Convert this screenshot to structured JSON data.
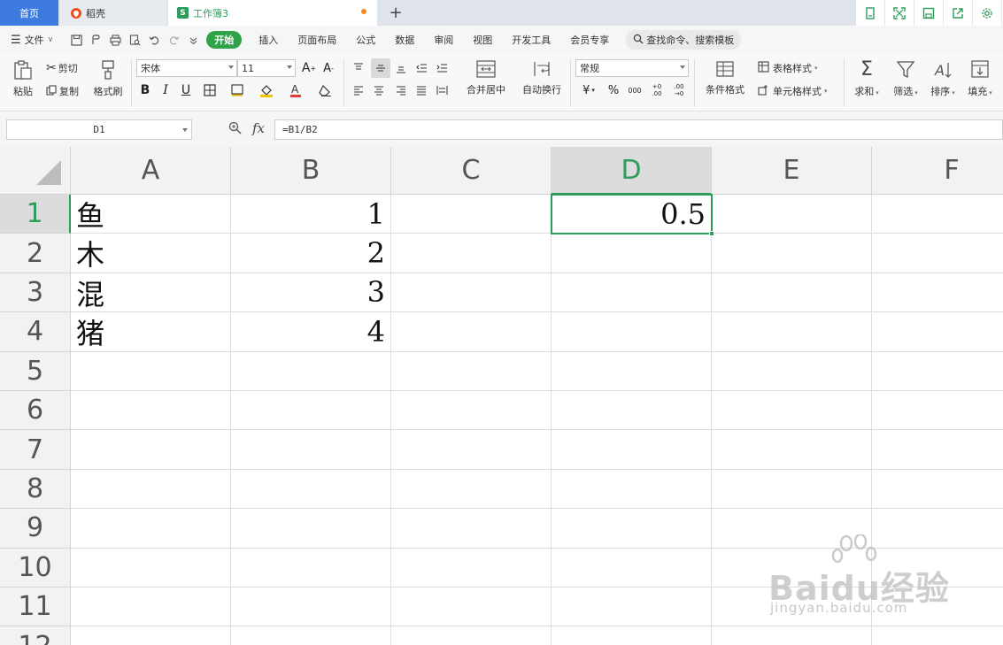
{
  "tabs": {
    "home": "首页",
    "docer": "稻壳",
    "workbook": "工作簿3"
  },
  "menu": {
    "file": "文件",
    "items": [
      "开始",
      "插入",
      "页面布局",
      "公式",
      "数据",
      "审阅",
      "视图",
      "开发工具",
      "会员专享"
    ],
    "search": "查找命令、搜索模板"
  },
  "ribbon": {
    "paste": "粘贴",
    "cut": "剪切",
    "copy": "复制",
    "format_painter": "格式刷",
    "font_name": "宋体",
    "font_size": "11",
    "merge_center": "合并居中",
    "wrap_text": "自动换行",
    "number_format": "常规",
    "conditional_format": "条件格式",
    "table_style": "表格样式",
    "cell_style": "单元格样式",
    "sum": "求和",
    "filter": "筛选",
    "sort": "排序",
    "fill": "填充"
  },
  "formula_bar": {
    "name_box": "D1",
    "fx": "fx",
    "formula": "=B1/B2"
  },
  "sheet": {
    "columns": [
      "A",
      "B",
      "C",
      "D",
      "E",
      "F"
    ],
    "rows": [
      "1",
      "2",
      "3",
      "4",
      "5",
      "6",
      "7",
      "8",
      "9",
      "10",
      "11",
      "12"
    ],
    "cells": {
      "A1": "鱼",
      "A2": "木",
      "A3": "混",
      "A4": "猪",
      "B1": "1",
      "B2": "2",
      "B3": "3",
      "B4": "4",
      "D1": "0.5"
    },
    "active_cell": "D1"
  },
  "watermark": {
    "brand": "Baidu经验",
    "url": "jingyan.baidu.com"
  },
  "colors": {
    "accent": "#2e9d5c",
    "home_tab": "#3d7be0",
    "start_button": "#2fa24a"
  }
}
